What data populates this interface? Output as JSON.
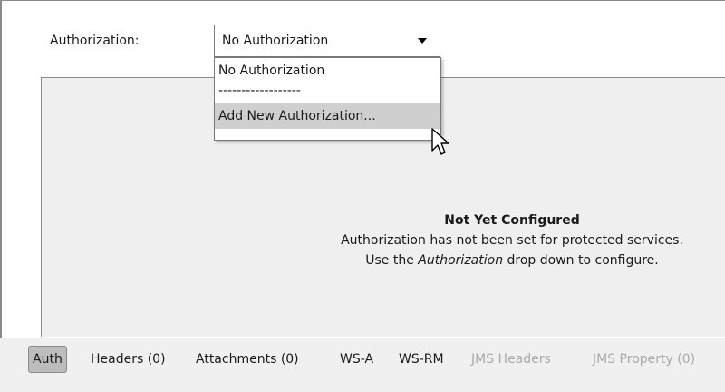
{
  "authorization": {
    "label": "Authorization:",
    "selected": "No Authorization",
    "options": [
      "No Authorization",
      "------------------",
      "Add New Authorization..."
    ]
  },
  "message": {
    "title": "Not Yet Configured",
    "line1": "Authorization has not been set for protected services.",
    "line2_prefix": "Use the ",
    "line2_em": "Authorization",
    "line2_suffix": " drop down to configure."
  },
  "tabs": [
    {
      "label": "Auth",
      "state": "active"
    },
    {
      "label": "Headers (0)",
      "state": "enabled"
    },
    {
      "label": "Attachments (0)",
      "state": "enabled"
    },
    {
      "label": "WS-A",
      "state": "enabled"
    },
    {
      "label": "WS-RM",
      "state": "enabled"
    },
    {
      "label": "JMS Headers",
      "state": "disabled"
    },
    {
      "label": "JMS Property (0)",
      "state": "disabled"
    }
  ],
  "icons": {
    "dropdown_arrow": "chevron-down-icon",
    "cursor": "mouse-pointer-icon"
  }
}
